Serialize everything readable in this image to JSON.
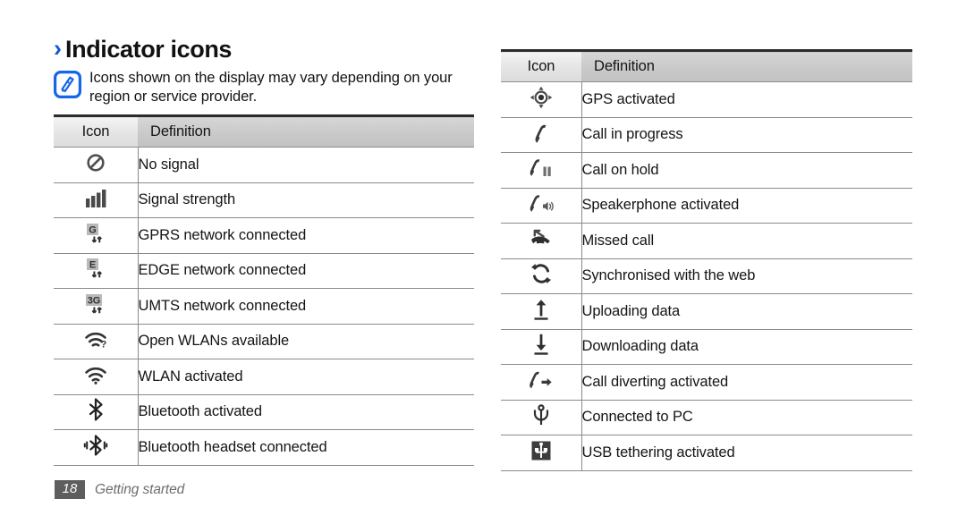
{
  "page": {
    "heading": "Indicator icons",
    "chevron": "›",
    "note": "Icons shown on the display may vary depending on your region or service provider.",
    "note_icon": "note-pencil-icon",
    "accent_color": "#1058d8",
    "header_fill": "#c9c9c9",
    "rule_color": "#8a8a8a"
  },
  "footer": {
    "page_number": "18",
    "label": "Getting started"
  },
  "tables": [
    {
      "id": "left-table",
      "columns": [
        "Icon",
        "Definition"
      ],
      "rows": [
        {
          "icon": "no-signal-icon",
          "definition": "No signal"
        },
        {
          "icon": "signal-strength-icon",
          "definition": "Signal strength"
        },
        {
          "icon": "gprs-network-icon",
          "definition": "GPRS network connected"
        },
        {
          "icon": "edge-network-icon",
          "definition": "EDGE network connected"
        },
        {
          "icon": "umts-network-icon",
          "definition": "UMTS network connected"
        },
        {
          "icon": "open-wlan-icon",
          "definition": "Open WLANs available"
        },
        {
          "icon": "wlan-activated-icon",
          "definition": "WLAN activated"
        },
        {
          "icon": "bluetooth-icon",
          "definition": "Bluetooth activated"
        },
        {
          "icon": "bluetooth-headset-icon",
          "definition": "Bluetooth headset connected"
        }
      ]
    },
    {
      "id": "right-table",
      "columns": [
        "Icon",
        "Definition"
      ],
      "rows": [
        {
          "icon": "gps-icon",
          "definition": "GPS activated"
        },
        {
          "icon": "call-in-progress-icon",
          "definition": "Call in progress"
        },
        {
          "icon": "call-on-hold-icon",
          "definition": "Call on hold"
        },
        {
          "icon": "speakerphone-icon",
          "definition": "Speakerphone activated"
        },
        {
          "icon": "missed-call-icon",
          "definition": "Missed call"
        },
        {
          "icon": "sync-web-icon",
          "definition": "Synchronised with the web"
        },
        {
          "icon": "upload-icon",
          "definition": "Uploading data"
        },
        {
          "icon": "download-icon",
          "definition": "Downloading data"
        },
        {
          "icon": "call-diverting-icon",
          "definition": "Call diverting activated"
        },
        {
          "icon": "usb-connected-icon",
          "definition": "Connected to PC"
        },
        {
          "icon": "usb-tethering-icon",
          "definition": "USB tethering activated"
        }
      ]
    }
  ]
}
